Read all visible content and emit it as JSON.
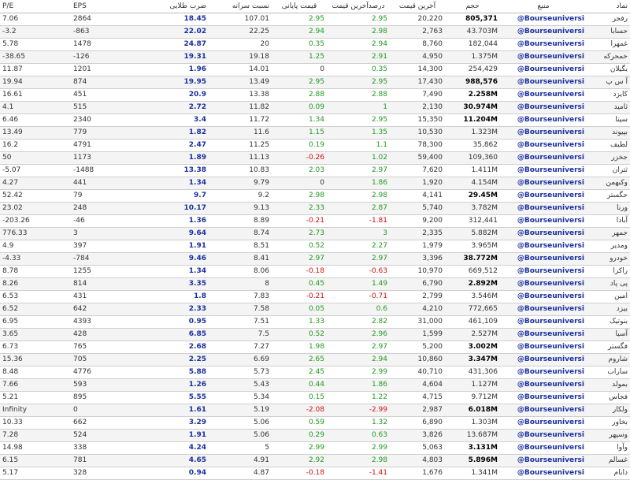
{
  "headers": {
    "pe": "P/E",
    "eps": "EPS",
    "gold": "ضرب طلایی",
    "ratio": "نسبت سرانه",
    "close": "قیمت پایانی",
    "lastpct": "درصدآخرین قیمت",
    "last": "آخرین قیمت",
    "vol": "حجم",
    "src": "منبع",
    "sym": "نماد"
  },
  "rows": [
    {
      "pe": "7.06",
      "eps": "2864",
      "gold": "18.45",
      "ratio": "107.01",
      "close": "2.95",
      "lastpct": "2.95",
      "last": "20,220",
      "vol": "805,371",
      "src": "@Bourseuniversi",
      "sym": "رفجر"
    },
    {
      "pe": "-3.2",
      "eps": "-863",
      "gold": "22.02",
      "ratio": "22.25",
      "close": "2.94",
      "lastpct": "2.98",
      "last": "2,763",
      "vol": "43.703M",
      "src": "@Bourseuniversi",
      "sym": "حسابا"
    },
    {
      "pe": "5.78",
      "eps": "1478",
      "gold": "24.87",
      "ratio": "20",
      "close": "0.35",
      "lastpct": "2.94",
      "last": "8,760",
      "vol": "182,044",
      "src": "@Bourseuniversi",
      "sym": "غمهرا"
    },
    {
      "pe": "-38.65",
      "eps": "-126",
      "gold": "19.31",
      "ratio": "19.18",
      "close": "1.25",
      "lastpct": "2.91",
      "last": "4,950",
      "vol": "1.375M",
      "src": "@Bourseuniversi",
      "sym": "خمحرکه"
    },
    {
      "pe": "11.87",
      "eps": "1201",
      "gold": "1.96",
      "ratio": "14.01",
      "close": "0",
      "lastpct": "0.35",
      "last": "14,300",
      "vol": "254,429",
      "src": "@Bourseuniversi",
      "sym": "بگیلان"
    },
    {
      "pe": "19.94",
      "eps": "874",
      "gold": "19.95",
      "ratio": "13.49",
      "close": "2.95",
      "lastpct": "2.95",
      "last": "17,430",
      "vol": "988,576",
      "src": "@Bourseuniversi",
      "sym": "آ س پ"
    },
    {
      "pe": "16.61",
      "eps": "451",
      "gold": "20.9",
      "ratio": "13.38",
      "close": "2.88",
      "lastpct": "2.88",
      "last": "7,490",
      "vol": "2.258M",
      "src": "@Bourseuniversi",
      "sym": "کایزد"
    },
    {
      "pe": "4.1",
      "eps": "515",
      "gold": "2.72",
      "ratio": "11.82",
      "close": "0.09",
      "lastpct": "1",
      "last": "2,130",
      "vol": "30.974M",
      "src": "@Bourseuniversi",
      "sym": "ثامید"
    },
    {
      "pe": "6.46",
      "eps": "2340",
      "gold": "3.4",
      "ratio": "11.72",
      "close": "1.34",
      "lastpct": "2.95",
      "last": "15,350",
      "vol": "11.204M",
      "src": "@Bourseuniversi",
      "sym": "سیتا"
    },
    {
      "pe": "13.49",
      "eps": "779",
      "gold": "1.82",
      "ratio": "11.6",
      "close": "1.15",
      "lastpct": "1.35",
      "last": "10,530",
      "vol": "1.323M",
      "src": "@Bourseuniversi",
      "sym": "بپیوند"
    },
    {
      "pe": "16.2",
      "eps": "4791",
      "gold": "2.47",
      "ratio": "11.25",
      "close": "0.19",
      "lastpct": "1.1",
      "last": "78,300",
      "vol": "35,862",
      "src": "@Bourseuniversi",
      "sym": "لطیف"
    },
    {
      "pe": "50",
      "eps": "1173",
      "gold": "1.89",
      "ratio": "11.13",
      "close": "-0.26",
      "lastpct": "1.02",
      "last": "59,400",
      "vol": "109,360",
      "src": "@Bourseuniversi",
      "sym": "جخزر"
    },
    {
      "pe": "-5.07",
      "eps": "-1488",
      "gold": "13.38",
      "ratio": "10.83",
      "close": "2.03",
      "lastpct": "2.97",
      "last": "7,620",
      "vol": "1.411M",
      "src": "@Bourseuniversi",
      "sym": "ثتران"
    },
    {
      "pe": "4.27",
      "eps": "441",
      "gold": "1.34",
      "ratio": "9.79",
      "close": "0",
      "lastpct": "1.86",
      "last": "1,920",
      "vol": "4.154M",
      "src": "@Bourseuniversi",
      "sym": "وکبهمن"
    },
    {
      "pe": "52.42",
      "eps": "79",
      "gold": "9.7",
      "ratio": "9.2",
      "close": "2.98",
      "lastpct": "2.98",
      "last": "4,141",
      "vol": "29.45M",
      "src": "@Bourseuniversi",
      "sym": "حگستر"
    },
    {
      "pe": "23.02",
      "eps": "248",
      "gold": "10.17",
      "ratio": "9.13",
      "close": "2.33",
      "lastpct": "2.87",
      "last": "5,740",
      "vol": "3.782M",
      "src": "@Bourseuniversi",
      "sym": "ورنا"
    },
    {
      "pe": "-203.26",
      "eps": "-46",
      "gold": "1.36",
      "ratio": "8.89",
      "close": "-0.21",
      "lastpct": "-1.81",
      "last": "9,200",
      "vol": "312,441",
      "src": "@Bourseuniversi",
      "sym": "آبادا"
    },
    {
      "pe": "776.33",
      "eps": "3",
      "gold": "9.64",
      "ratio": "8.74",
      "close": "2.73",
      "lastpct": "3",
      "last": "2,335",
      "vol": "5.882M",
      "src": "@Bourseuniversi",
      "sym": "جمهر"
    },
    {
      "pe": "4.9",
      "eps": "397",
      "gold": "1.91",
      "ratio": "8.51",
      "close": "0.52",
      "lastpct": "2.27",
      "last": "1,979",
      "vol": "3.965M",
      "src": "@Bourseuniversi",
      "sym": "ومدیر"
    },
    {
      "pe": "-4.33",
      "eps": "-784",
      "gold": "9.46",
      "ratio": "8.41",
      "close": "2.97",
      "lastpct": "2.97",
      "last": "3,396",
      "vol": "38.772M",
      "src": "@Bourseuniversi",
      "sym": "خودرو"
    },
    {
      "pe": "8.78",
      "eps": "1255",
      "gold": "1.34",
      "ratio": "8.06",
      "close": "-0.18",
      "lastpct": "-0.63",
      "last": "10,970",
      "vol": "669,512",
      "src": "@Bourseuniversi",
      "sym": "راکرا"
    },
    {
      "pe": "8.26",
      "eps": "814",
      "gold": "3.35",
      "ratio": "8",
      "close": "0.45",
      "lastpct": "1.49",
      "last": "6,790",
      "vol": "2.892M",
      "src": "@Bourseuniversi",
      "sym": "پی پاد"
    },
    {
      "pe": "6.53",
      "eps": "431",
      "gold": "1.8",
      "ratio": "7.83",
      "close": "-0.21",
      "lastpct": "-0.71",
      "last": "2,799",
      "vol": "3.546M",
      "src": "@Bourseuniversi",
      "sym": "امین"
    },
    {
      "pe": "6.52",
      "eps": "642",
      "gold": "2.33",
      "ratio": "7.58",
      "close": "0.05",
      "lastpct": "0.6",
      "last": "4,210",
      "vol": "772,665",
      "src": "@Bourseuniversi",
      "sym": "بیزد"
    },
    {
      "pe": "6.95",
      "eps": "4393",
      "gold": "0.95",
      "ratio": "7.51",
      "close": "1.33",
      "lastpct": "2.82",
      "last": "31,000",
      "vol": "461,109",
      "src": "@Bourseuniversi",
      "sym": "بنوتیک"
    },
    {
      "pe": "3.65",
      "eps": "428",
      "gold": "6.85",
      "ratio": "7.5",
      "close": "0.52",
      "lastpct": "2.96",
      "last": "1,599",
      "vol": "2.527M",
      "src": "@Bourseuniversi",
      "sym": "آسیا"
    },
    {
      "pe": "6.73",
      "eps": "765",
      "gold": "2.68",
      "ratio": "7.27",
      "close": "1.98",
      "lastpct": "2.97",
      "last": "5,200",
      "vol": "3.002M",
      "src": "@Bourseuniversi",
      "sym": "فگستر"
    },
    {
      "pe": "15.36",
      "eps": "705",
      "gold": "2.25",
      "ratio": "6.69",
      "close": "2.65",
      "lastpct": "2.94",
      "last": "10,860",
      "vol": "3.347M",
      "src": "@Bourseuniversi",
      "sym": "شاروم"
    },
    {
      "pe": "8.48",
      "eps": "4776",
      "gold": "5.88",
      "ratio": "5.73",
      "close": "2.45",
      "lastpct": "2.99",
      "last": "40,710",
      "vol": "431,306",
      "src": "@Bourseuniversi",
      "sym": "ساراب"
    },
    {
      "pe": "7.66",
      "eps": "593",
      "gold": "1.26",
      "ratio": "5.43",
      "close": "0.44",
      "lastpct": "1.86",
      "last": "4,604",
      "vol": "1.127M",
      "src": "@Bourseuniversi",
      "sym": "بمولد"
    },
    {
      "pe": "5.21",
      "eps": "895",
      "gold": "5.55",
      "ratio": "5.34",
      "close": "0.15",
      "lastpct": "1.22",
      "last": "4,715",
      "vol": "9.712M",
      "src": "@Bourseuniversi",
      "sym": "فجاس"
    },
    {
      "pe": "Infinity",
      "eps": "0",
      "gold": "1.61",
      "ratio": "5.19",
      "close": "-2.08",
      "lastpct": "-2.99",
      "last": "2,987",
      "vol": "6.018M",
      "src": "@Bourseuniversi",
      "sym": "ولکار"
    },
    {
      "pe": "10.33",
      "eps": "662",
      "gold": "3.29",
      "ratio": "5.06",
      "close": "0.59",
      "lastpct": "1.32",
      "last": "6,890",
      "vol": "1.303M",
      "src": "@Bourseuniversi",
      "sym": "بخاور"
    },
    {
      "pe": "7.28",
      "eps": "524",
      "gold": "1.91",
      "ratio": "5.06",
      "close": "0.29",
      "lastpct": "0.63",
      "last": "3,826",
      "vol": "13.687M",
      "src": "@Bourseuniversi",
      "sym": "وسپهر"
    },
    {
      "pe": "14.98",
      "eps": "338",
      "gold": "4.24",
      "ratio": "5",
      "close": "2.99",
      "lastpct": "2.99",
      "last": "5,063",
      "vol": "3.131M",
      "src": "@Bourseuniversi",
      "sym": "وآوا"
    },
    {
      "pe": "6.15",
      "eps": "781",
      "gold": "4.65",
      "ratio": "4.91",
      "close": "2.92",
      "lastpct": "2.98",
      "last": "4,803",
      "vol": "5.896M",
      "src": "@Bourseuniversi",
      "sym": "غسالم"
    },
    {
      "pe": "5.17",
      "eps": "328",
      "gold": "0.94",
      "ratio": "4.87",
      "close": "-0.18",
      "lastpct": "-1.41",
      "last": "1,676",
      "vol": "1.341M",
      "src": "@Bourseuniversi",
      "sym": "دانام"
    }
  ],
  "bold_volume_rows": [
    0,
    5,
    6,
    7,
    8,
    14,
    19,
    21,
    26,
    27,
    31,
    34,
    35
  ],
  "colors": {
    "positive": "#1f9a1f",
    "negative": "#d01010",
    "accent": "#1a2fa0"
  }
}
